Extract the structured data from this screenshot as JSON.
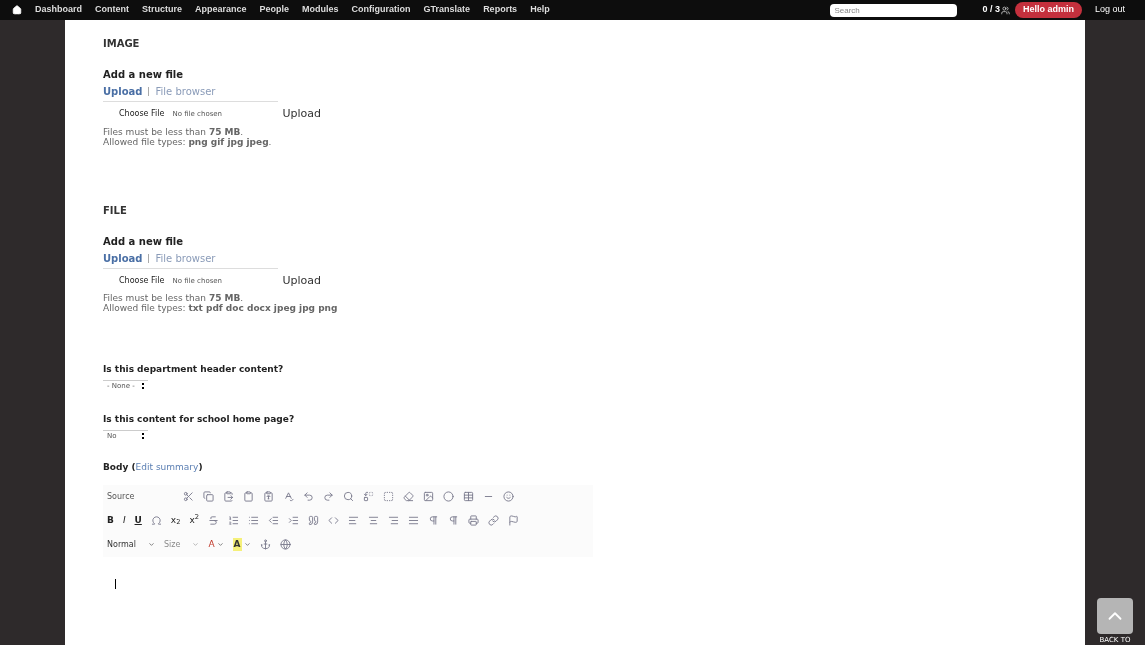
{
  "admin_menu": {
    "items": [
      "Dashboard",
      "Content",
      "Structure",
      "Appearance",
      "People",
      "Modules",
      "Configuration",
      "GTranslate",
      "Reports",
      "Help"
    ],
    "search": {
      "placeholder": "Search"
    },
    "counter": "0 / 3",
    "greeting": "Hello admin",
    "logout": "Log out"
  },
  "sections": [
    {
      "heading": "IMAGE",
      "subheading": "Add a new file",
      "methods": [
        {
          "label": "Upload",
          "selected": true
        },
        {
          "label": "File browser",
          "selected": false
        }
      ],
      "choose_button": "Choose File",
      "file_status": "No file chosen",
      "upload_button": "Upload",
      "size_note": "Files must be less than **75 MB**.",
      "types_note": "Allowed file types: **png gif jpg jpeg**."
    },
    {
      "heading": "FILE",
      "subheading": "Add a new file",
      "methods": [
        {
          "label": "Upload",
          "selected": true
        },
        {
          "label": "File browser",
          "selected": false
        }
      ],
      "choose_button": "Choose File",
      "file_status": "No file chosen",
      "upload_button": "Upload",
      "size_note": "Files must be less than **75 MB**.",
      "types_note": "Allowed file types: **txt pdf doc docx jpeg jpg png**"
    }
  ],
  "selects": [
    {
      "label": "Is this department header content?",
      "value": "- None -"
    },
    {
      "label": "Is this content for school home page?",
      "value": "No"
    }
  ],
  "body": {
    "label": "Body (",
    "link": "Edit summary",
    "closing": ")",
    "toolbar_rows": [
      [
        {
          "kind": "text",
          "label": "Source",
          "disabled": false
        },
        {
          "kind": "icon"
        },
        {
          "kind": "icon"
        },
        {
          "kind": "icon"
        },
        {
          "kind": "icon"
        },
        {
          "kind": "icon"
        },
        {
          "kind": "icon"
        },
        {
          "kind": "icon"
        },
        {
          "kind": "icon"
        },
        {
          "kind": "icon"
        },
        {
          "kind": "icon"
        },
        {
          "kind": "icon"
        },
        {
          "kind": "icon"
        },
        {
          "kind": "icon"
        },
        {
          "kind": "icon"
        },
        {
          "kind": "icon"
        },
        {
          "kind": "icon"
        },
        {
          "kind": "icon"
        }
      ],
      [
        {
          "kind": "bold",
          "label": "B"
        },
        {
          "kind": "italic",
          "label": "I"
        },
        {
          "kind": "underline",
          "label": "U"
        },
        {
          "kind": "icon"
        },
        {
          "kind": "script",
          "label": "x$_{2}$"
        },
        {
          "kind": "script",
          "label": "x$^{2}$"
        },
        {
          "kind": "icon"
        },
        {
          "kind": "icon"
        },
        {
          "kind": "icon"
        },
        {
          "kind": "icon"
        },
        {
          "kind": "icon"
        },
        {
          "kind": "icon"
        },
        {
          "kind": "icon"
        },
        {
          "kind": "icon"
        },
        {
          "kind": "icon"
        },
        {
          "kind": "icon"
        },
        {
          "kind": "icon"
        },
        {
          "kind": "icon"
        },
        {
          "kind": "icon"
        },
        {
          "kind": "icon"
        },
        {
          "kind": "icon"
        },
        {
          "kind": "icon"
        }
      ],
      [
        {
          "kind": "dropdown",
          "label": "Normal",
          "disabled": false
        },
        {
          "kind": "dropdown",
          "label": "Size",
          "disabled": true
        },
        {
          "kind": "textcolor",
          "label": "A"
        },
        {
          "kind": "bgcolor",
          "label": "A"
        },
        {
          "kind": "icon"
        },
        {
          "kind": "icon"
        }
      ]
    ]
  },
  "back_to_top": {
    "label": "BACK TO"
  }
}
